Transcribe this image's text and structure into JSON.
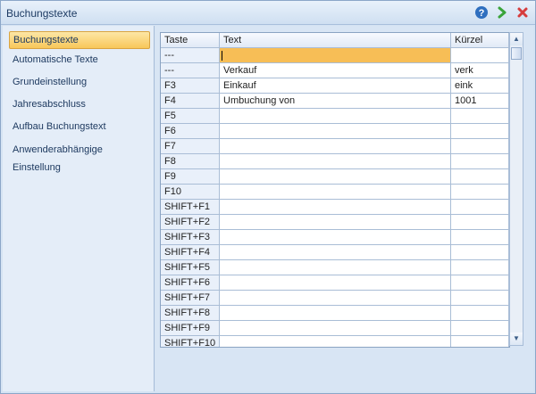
{
  "window": {
    "title": "Buchungstexte"
  },
  "sidebar": {
    "items": [
      {
        "label": "Buchungstexte",
        "active": true
      },
      {
        "label": "Automatische Texte",
        "active": false
      },
      {
        "label": "Grundeinstellung",
        "active": false
      },
      {
        "label": "Jahresabschluss",
        "active": false
      },
      {
        "label": "Aufbau Buchungstext",
        "active": false
      },
      {
        "label": "Anwenderabhängige Einstellung",
        "active": false
      }
    ]
  },
  "table": {
    "columns": [
      "Taste",
      "Text",
      "Kürzel"
    ],
    "rows": [
      {
        "taste": "---",
        "text": "",
        "kuerzel": ""
      },
      {
        "taste": "---",
        "text": "Verkauf",
        "kuerzel": "verk"
      },
      {
        "taste": "F3",
        "text": "Einkauf",
        "kuerzel": "eink"
      },
      {
        "taste": "F4",
        "text": "Umbuchung von",
        "kuerzel": "1001"
      },
      {
        "taste": "F5",
        "text": "",
        "kuerzel": ""
      },
      {
        "taste": "F6",
        "text": "",
        "kuerzel": ""
      },
      {
        "taste": "F7",
        "text": "",
        "kuerzel": ""
      },
      {
        "taste": "F8",
        "text": "",
        "kuerzel": ""
      },
      {
        "taste": "F9",
        "text": "",
        "kuerzel": ""
      },
      {
        "taste": "F10",
        "text": "",
        "kuerzel": ""
      },
      {
        "taste": "SHIFT+F1",
        "text": "",
        "kuerzel": ""
      },
      {
        "taste": "SHIFT+F2",
        "text": "",
        "kuerzel": ""
      },
      {
        "taste": "SHIFT+F3",
        "text": "",
        "kuerzel": ""
      },
      {
        "taste": "SHIFT+F4",
        "text": "",
        "kuerzel": ""
      },
      {
        "taste": "SHIFT+F5",
        "text": "",
        "kuerzel": ""
      },
      {
        "taste": "SHIFT+F6",
        "text": "",
        "kuerzel": ""
      },
      {
        "taste": "SHIFT+F7",
        "text": "",
        "kuerzel": ""
      },
      {
        "taste": "SHIFT+F8",
        "text": "",
        "kuerzel": ""
      },
      {
        "taste": "SHIFT+F9",
        "text": "",
        "kuerzel": ""
      },
      {
        "taste": "SHIFT+F10",
        "text": "",
        "kuerzel": ""
      }
    ]
  },
  "icons": {
    "help": "help-icon",
    "next": "green-arrow-next-icon",
    "close": "red-close-icon"
  },
  "colors": {
    "selection": "#f7be56",
    "accent_blue": "#3f7fd1",
    "next_green": "#39a43a",
    "close_red": "#d63d3d"
  }
}
